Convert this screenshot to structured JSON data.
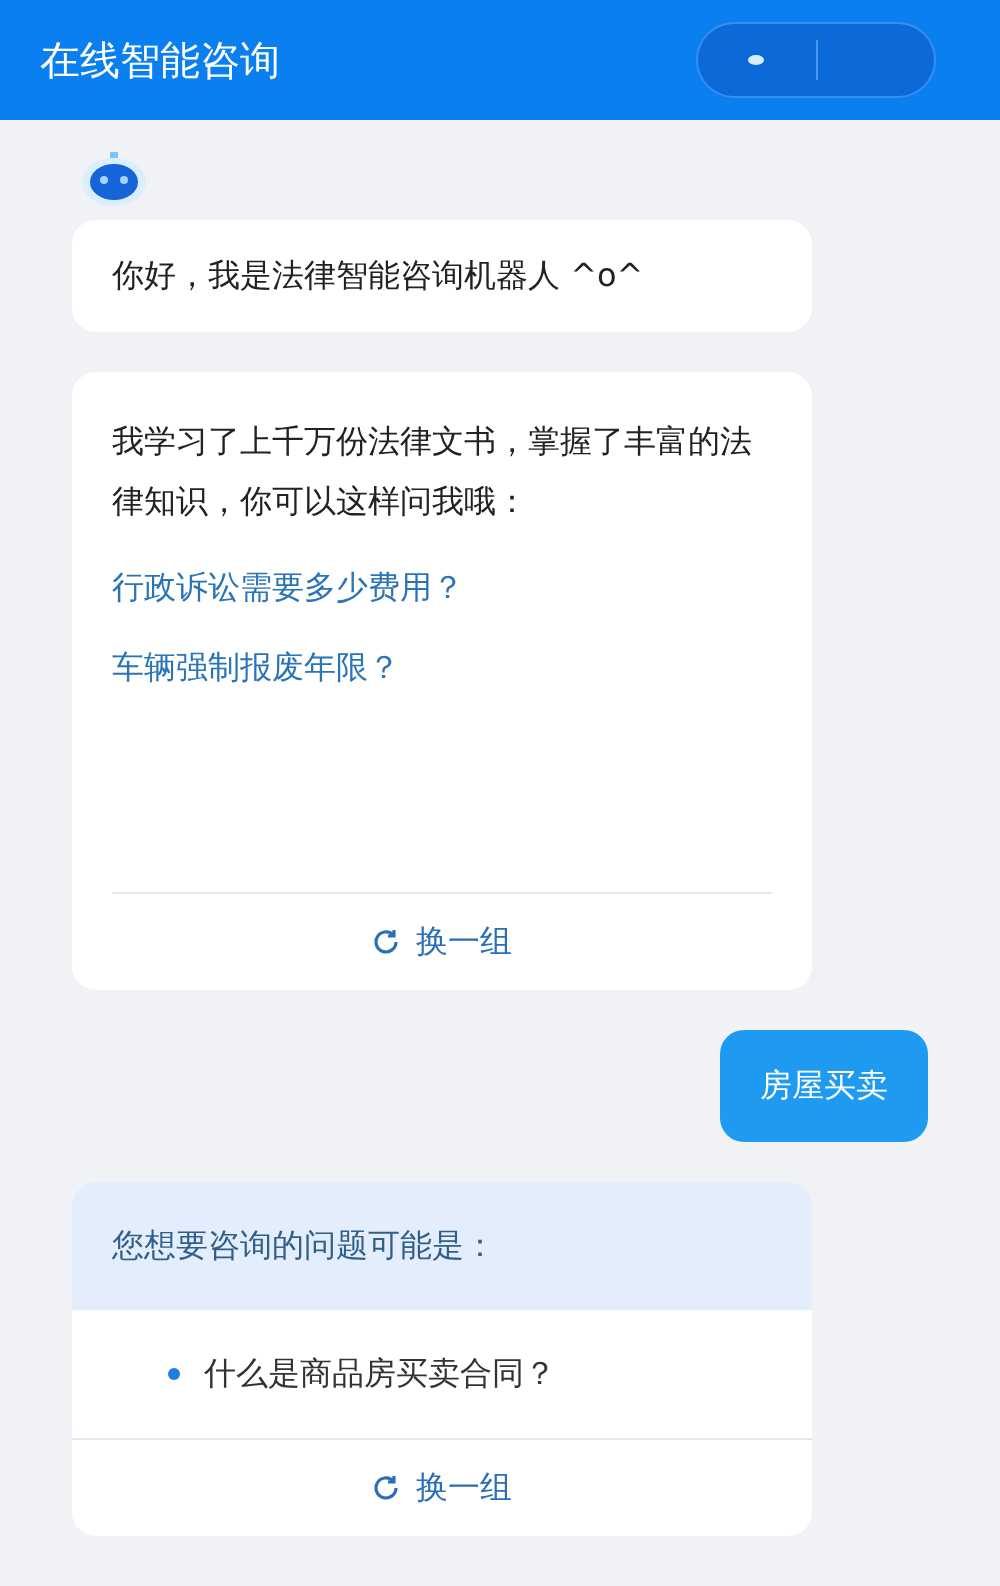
{
  "header": {
    "title": "在线智能咨询"
  },
  "messages": [
    {
      "kind": "bot",
      "text": "你好，我是法律智能咨询机器人 ^o^"
    },
    {
      "kind": "examples",
      "text": "我学习了上千万份法律文书，掌握了丰富的法律知识，你可以这样问我哦：",
      "links": [
        "行政诉讼需要多少费用？",
        "车辆强制报废年限？"
      ],
      "refresh": "换一组"
    },
    {
      "kind": "user",
      "text": "房屋买卖"
    },
    {
      "kind": "suggest",
      "title": "您想要咨询的问题可能是：",
      "items": [
        "什么是商品房买卖合同？"
      ],
      "refresh": "换一组"
    }
  ]
}
